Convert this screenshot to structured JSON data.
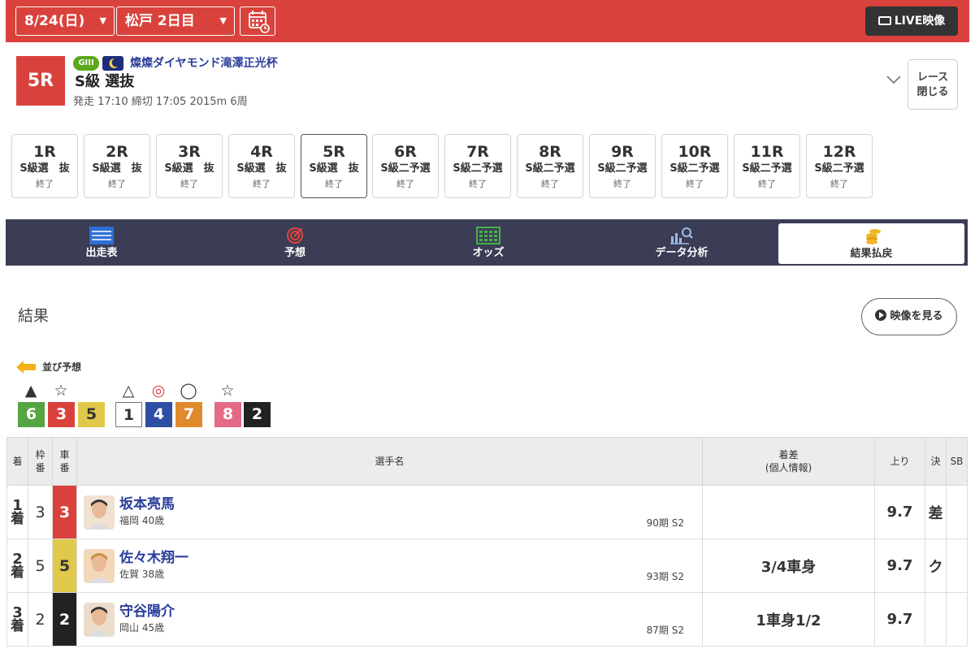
{
  "topbar": {
    "date": "8/24(日)",
    "venue_day": "松戸 2日目",
    "live_label": "LIVE映像",
    "bg_color": "#d9423c"
  },
  "race": {
    "number": "5R",
    "grade": "GIII",
    "cup_name": "燦燦ダイヤモンド滝澤正光杯",
    "class": "S級 選抜",
    "info": "発走 17:10 締切 17:05 2015m 6周",
    "close_label_1": "レース",
    "close_label_2": "閉じる"
  },
  "race_tabs": [
    {
      "num": "1R",
      "cls": "S級選　抜",
      "status": "終了"
    },
    {
      "num": "2R",
      "cls": "S級選　抜",
      "status": "終了"
    },
    {
      "num": "3R",
      "cls": "S級選　抜",
      "status": "終了"
    },
    {
      "num": "4R",
      "cls": "S級選　抜",
      "status": "終了"
    },
    {
      "num": "5R",
      "cls": "S級選　抜",
      "status": "終了"
    },
    {
      "num": "6R",
      "cls": "S級二予選",
      "status": "終了"
    },
    {
      "num": "7R",
      "cls": "S級二予選",
      "status": "終了"
    },
    {
      "num": "8R",
      "cls": "S級二予選",
      "status": "終了"
    },
    {
      "num": "9R",
      "cls": "S級二予選",
      "status": "終了"
    },
    {
      "num": "10R",
      "cls": "S級二予選",
      "status": "終了"
    },
    {
      "num": "11R",
      "cls": "S級二予選",
      "status": "終了"
    },
    {
      "num": "12R",
      "cls": "S級二予選",
      "status": "終了"
    }
  ],
  "nav": [
    {
      "label": "出走表",
      "icon": "entry-table-icon"
    },
    {
      "label": "予想",
      "icon": "target-icon"
    },
    {
      "label": "オッズ",
      "icon": "odds-board-icon"
    },
    {
      "label": "データ分析",
      "icon": "chart-search-icon"
    },
    {
      "label": "結果払戻",
      "icon": "coins-icon"
    }
  ],
  "results": {
    "title": "結果",
    "video_label": "映像を見る",
    "narabi_label": "並び予想",
    "narabi": [
      {
        "mark": "▲",
        "num": "6"
      },
      {
        "mark": "☆",
        "num": "3"
      },
      {
        "mark": "",
        "num": "5"
      },
      {
        "mark": "△",
        "num": "1"
      },
      {
        "mark": "◎",
        "num": "4"
      },
      {
        "mark": "◯",
        "num": "7"
      },
      {
        "mark": "☆",
        "num": "8"
      },
      {
        "mark": "",
        "num": "2"
      }
    ],
    "headers": {
      "rank": "着",
      "frame_1": "枠",
      "frame_2": "番",
      "car_1": "車",
      "car_2": "番",
      "name": "選手名",
      "margin_1": "着差",
      "margin_2": "(個人情報)",
      "agari": "上り",
      "kimete": "決",
      "sb": "SB"
    },
    "rows": [
      {
        "rank_num": "1",
        "rank_suffix": "着",
        "frame": "3",
        "car": "3",
        "name": "坂本亮馬",
        "info": "福岡 40歳",
        "term": "90期 S2",
        "margin": "",
        "agari": "9.7",
        "kimete": "差",
        "sb": ""
      },
      {
        "rank_num": "2",
        "rank_suffix": "着",
        "frame": "5",
        "car": "5",
        "name": "佐々木翔一",
        "info": "佐賀 38歳",
        "term": "93期 S2",
        "margin": "3/4車身",
        "agari": "9.7",
        "kimete": "ク",
        "sb": ""
      },
      {
        "rank_num": "3",
        "rank_suffix": "着",
        "frame": "2",
        "car": "2",
        "name": "守谷陽介",
        "info": "岡山 45歳",
        "term": "87期 S2",
        "margin": "1車身1/2",
        "agari": "9.7",
        "kimete": "",
        "sb": ""
      }
    ]
  },
  "colors": {
    "car_1": "#ffffff",
    "car_2": "#222222",
    "car_3": "#d9423c",
    "car_4": "#2c4fa3",
    "car_5": "#e0c94a",
    "car_6": "#55a542",
    "car_7": "#df8a2c",
    "car_8": "#e46a86"
  }
}
